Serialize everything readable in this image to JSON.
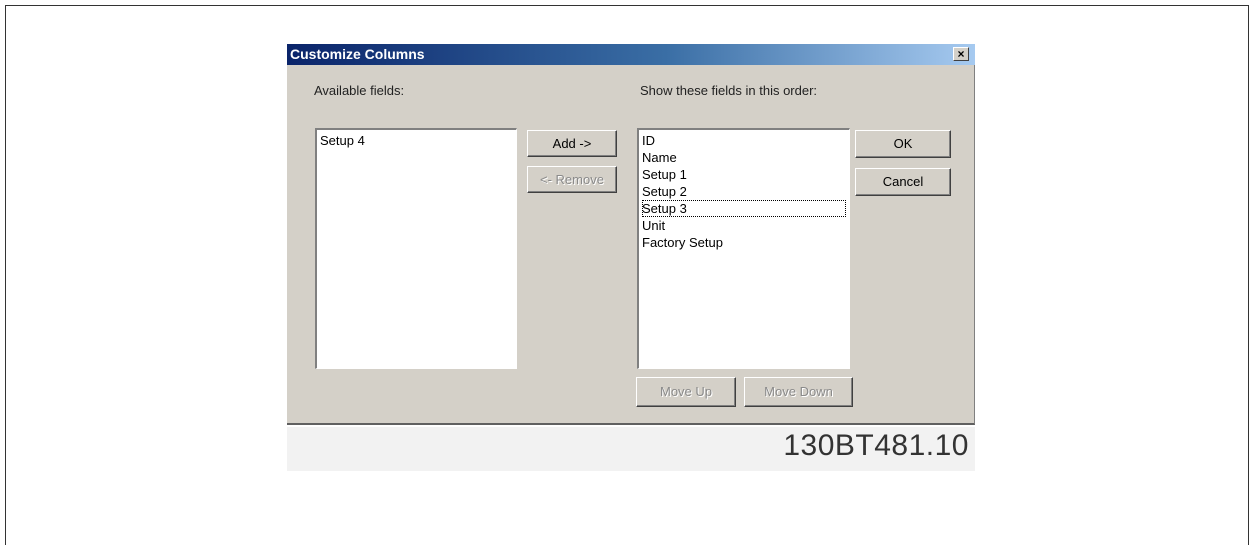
{
  "dialog": {
    "title": "Customize Columns",
    "close_label": "×",
    "available_label": "Available fields:",
    "order_label": "Show these fields in this order:"
  },
  "available_fields": [
    "Setup 4"
  ],
  "shown_fields": [
    "ID",
    "Name",
    "Setup 1",
    "Setup 2",
    "Setup 3",
    "Unit",
    "Factory Setup"
  ],
  "focused_field": "Setup 3",
  "buttons": {
    "add": "Add ->",
    "remove": "<- Remove",
    "ok": "OK",
    "cancel": "Cancel",
    "move_up": "Move Up",
    "move_down": "Move Down"
  },
  "figure_code": "130BT481.10"
}
